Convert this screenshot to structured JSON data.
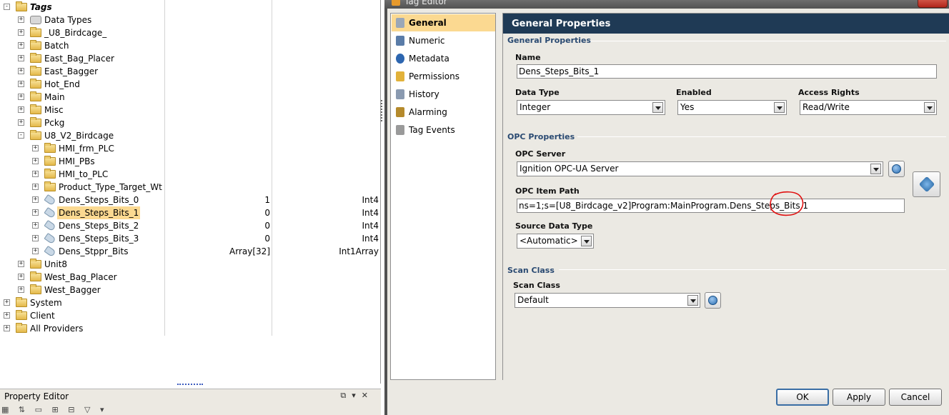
{
  "tree": {
    "root_label": "Tags",
    "rows": [
      {
        "label": "Data Types",
        "depth": 1,
        "icon": "gear-folder-icon",
        "expand": "+"
      },
      {
        "label": "_U8_Birdcage_",
        "depth": 1,
        "icon": "folder-icon",
        "expand": "+"
      },
      {
        "label": "Batch",
        "depth": 1,
        "icon": "folder-icon",
        "expand": "+"
      },
      {
        "label": "East_Bag_Placer",
        "depth": 1,
        "icon": "folder-icon",
        "expand": "+"
      },
      {
        "label": "East_Bagger",
        "depth": 1,
        "icon": "folder-icon",
        "expand": "+"
      },
      {
        "label": "Hot_End",
        "depth": 1,
        "icon": "folder-icon",
        "expand": "+"
      },
      {
        "label": "Main",
        "depth": 1,
        "icon": "folder-icon",
        "expand": "+"
      },
      {
        "label": "Misc",
        "depth": 1,
        "icon": "folder-icon",
        "expand": "+"
      },
      {
        "label": "Pckg",
        "depth": 1,
        "icon": "folder-icon",
        "expand": "+"
      },
      {
        "label": "U8_V2_Birdcage",
        "depth": 1,
        "icon": "folder-icon",
        "expand": "-"
      },
      {
        "label": "HMI_frm_PLC",
        "depth": 2,
        "icon": "folder-icon",
        "expand": "+"
      },
      {
        "label": "HMI_PBs",
        "depth": 2,
        "icon": "folder-icon",
        "expand": "+"
      },
      {
        "label": "HMI_to_PLC",
        "depth": 2,
        "icon": "folder-icon",
        "expand": "+"
      },
      {
        "label": "Product_Type_Target_Wt",
        "depth": 2,
        "icon": "folder-icon",
        "expand": "+"
      },
      {
        "label": "Dens_Steps_Bits_0",
        "depth": 2,
        "icon": "tag-icon",
        "expand": "+",
        "value": "1",
        "type": "Int4"
      },
      {
        "label": "Dens_Steps_Bits_1",
        "depth": 2,
        "icon": "tag-icon",
        "expand": "+",
        "value": "0",
        "type": "Int4",
        "selected": true
      },
      {
        "label": "Dens_Steps_Bits_2",
        "depth": 2,
        "icon": "tag-icon",
        "expand": "+",
        "value": "0",
        "type": "Int4"
      },
      {
        "label": "Dens_Steps_Bits_3",
        "depth": 2,
        "icon": "tag-icon",
        "expand": "+",
        "value": "0",
        "type": "Int4"
      },
      {
        "label": "Dens_Stppr_Bits",
        "depth": 2,
        "icon": "tag-icon",
        "expand": "+",
        "value": "Array[32]",
        "type": "Int1Array"
      },
      {
        "label": "Unit8",
        "depth": 1,
        "icon": "folder-icon",
        "expand": "+"
      },
      {
        "label": "West_Bag_Placer",
        "depth": 1,
        "icon": "folder-icon",
        "expand": "+"
      },
      {
        "label": "West_Bagger",
        "depth": 1,
        "icon": "folder-icon",
        "expand": "+"
      },
      {
        "label": "System",
        "depth": 0,
        "icon": "folder-icon",
        "expand": "+"
      },
      {
        "label": "Client",
        "depth": 0,
        "icon": "folder-icon",
        "expand": "+"
      },
      {
        "label": "All Providers",
        "depth": 0,
        "icon": "folder-icon",
        "expand": "+"
      }
    ]
  },
  "property_editor": {
    "title": "Property Editor",
    "dock_buttons": [
      "restore-icon",
      "pin-icon",
      "close-icon"
    ]
  },
  "dialog": {
    "title": "Tag Editor",
    "nav": [
      {
        "label": "General",
        "icon": "general-icon",
        "selected": true
      },
      {
        "label": "Numeric",
        "icon": "numeric-icon"
      },
      {
        "label": "Metadata",
        "icon": "info-icon"
      },
      {
        "label": "Permissions",
        "icon": "lock-icon"
      },
      {
        "label": "History",
        "icon": "history-icon"
      },
      {
        "label": "Alarming",
        "icon": "alarm-icon"
      },
      {
        "label": "Tag Events",
        "icon": "gears-icon"
      }
    ],
    "header": "General Properties",
    "general_section": "General Properties",
    "name_label": "Name",
    "name_value": "Dens_Steps_Bits_1",
    "data_type_label": "Data Type",
    "data_type_value": "Integer",
    "enabled_label": "Enabled",
    "enabled_value": "Yes",
    "access_label": "Access Rights",
    "access_value": "Read/Write",
    "opc_section": "OPC Properties",
    "opc_server_label": "OPC Server",
    "opc_server_value": "Ignition OPC-UA Server",
    "opc_path_label": "OPC Item Path",
    "opc_path_value": "ns=1;s=[U8_Birdcage_v2]Program:MainProgram.Dens_Steps_Bits.1",
    "source_type_label": "Source Data Type",
    "source_type_value": "<Automatic>",
    "scan_section": "Scan Class",
    "scan_label": "Scan Class",
    "scan_value": "Default",
    "buttons": {
      "ok": "OK",
      "apply": "Apply",
      "cancel": "Cancel"
    },
    "annotation_color": "#e01010"
  }
}
